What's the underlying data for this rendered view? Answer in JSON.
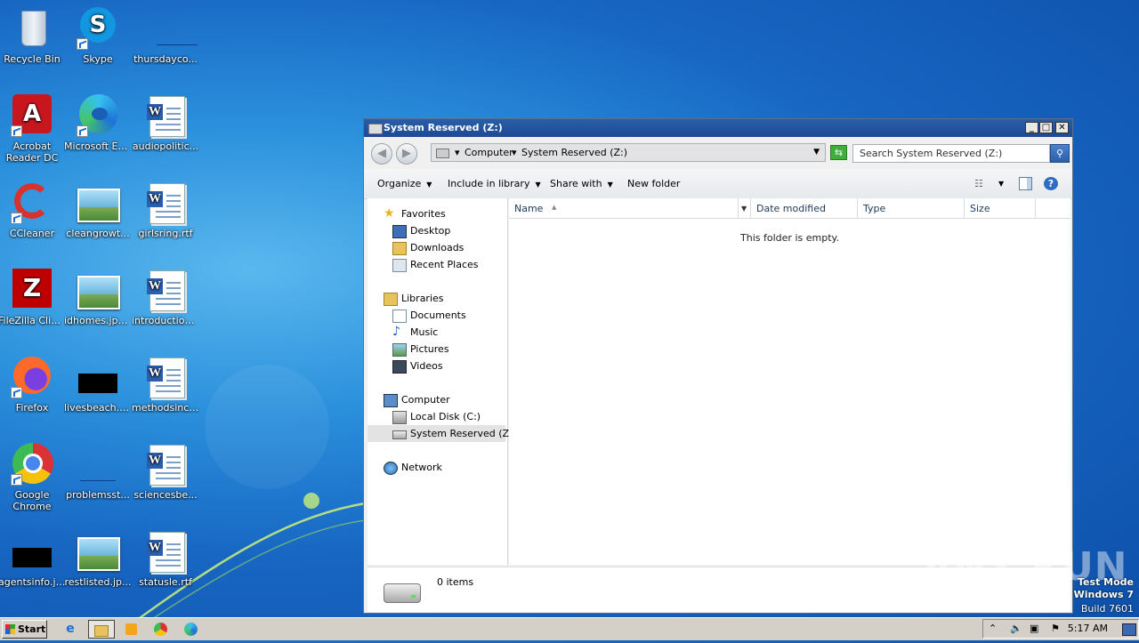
{
  "desktop": {
    "icons": [
      {
        "label": "Recycle Bin"
      },
      {
        "label": "Skype"
      },
      {
        "label": "thursdayco..."
      },
      {
        "label": "Acrobat Reader DC"
      },
      {
        "label": "Microsoft Edge"
      },
      {
        "label": "audiopolitic..."
      },
      {
        "label": "CCleaner"
      },
      {
        "label": "cleangrowt..."
      },
      {
        "label": "girlsring.rtf"
      },
      {
        "label": "FileZilla Client"
      },
      {
        "label": "idhomes.jpg..."
      },
      {
        "label": "introduction..."
      },
      {
        "label": "Firefox"
      },
      {
        "label": "livesbeach.jpg"
      },
      {
        "label": "methodsinc.rtf"
      },
      {
        "label": "Google Chrome"
      },
      {
        "label": "problemsst..."
      },
      {
        "label": "sciencesbe..."
      },
      {
        "label": "agentsinfo.jpg"
      },
      {
        "label": "restlisted.jp..."
      },
      {
        "label": "statusle.rtf"
      }
    ]
  },
  "window": {
    "title": "System Reserved (Z:)",
    "controls": {
      "minimize": "_",
      "maximize": "□",
      "close": "✕"
    },
    "address": {
      "crumbs": [
        "Computer",
        "System Reserved (Z:)"
      ]
    },
    "search_placeholder": "Search System Reserved (Z:)",
    "toolbar": {
      "organize": "Organize",
      "include_in_library": "Include in library",
      "share_with": "Share with",
      "new_folder": "New folder"
    },
    "nav": {
      "favorites": "Favorites",
      "desktop": "Desktop",
      "downloads": "Downloads",
      "recent_places": "Recent Places",
      "libraries": "Libraries",
      "documents": "Documents",
      "music": "Music",
      "pictures": "Pictures",
      "videos": "Videos",
      "computer": "Computer",
      "local_disk": "Local Disk (C:)",
      "system_reserved": "System Reserved (Z:)",
      "network": "Network"
    },
    "columns": [
      "Name",
      "Date modified",
      "Type",
      "Size"
    ],
    "empty_message": "This folder is empty.",
    "details": {
      "item_count": "0 items"
    }
  },
  "watermark": {
    "text": "ANY RUN"
  },
  "test_mode": {
    "line1": "Test Mode",
    "line2": "Windows 7",
    "line3": "Build 7601"
  },
  "taskbar": {
    "start_label": "Start",
    "clock": "5:17 AM"
  },
  "colors": {
    "titlebar": "#1c4a93",
    "desktop": "#1766c2",
    "taskbar": "#d4d0c8"
  }
}
